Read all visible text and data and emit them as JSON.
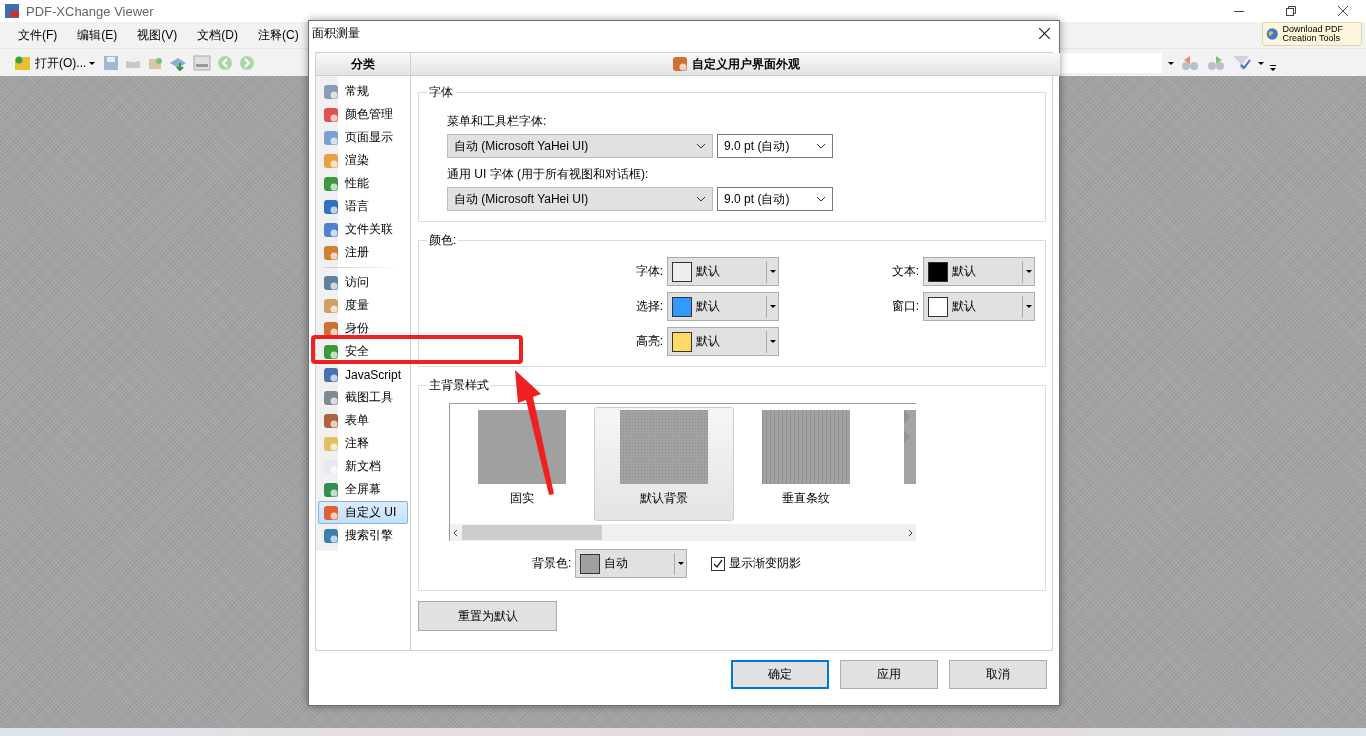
{
  "window": {
    "title": "PDF-XChange Viewer",
    "download_button": "Download PDF Creation Tools"
  },
  "menus": [
    {
      "label": "文件(F)"
    },
    {
      "label": "编辑(E)"
    },
    {
      "label": "视图(V)"
    },
    {
      "label": "文档(D)"
    },
    {
      "label": "注释(C)"
    }
  ],
  "toolbar": {
    "open_button": "打开(O)..."
  },
  "dialog": {
    "title": "面积测量",
    "category_header": "分类",
    "category_groups": [
      [
        {
          "label": "常规",
          "selected": false
        },
        {
          "label": "颜色管理",
          "selected": false
        },
        {
          "label": "页面显示",
          "selected": false
        },
        {
          "label": "渲染",
          "selected": false
        },
        {
          "label": "性能",
          "selected": false
        },
        {
          "label": "语言",
          "selected": false
        },
        {
          "label": "文件关联",
          "selected": false
        },
        {
          "label": "注册",
          "selected": false
        }
      ],
      [
        {
          "label": "访问",
          "selected": false
        },
        {
          "label": "度量",
          "selected": false
        },
        {
          "label": "身份",
          "selected": false
        },
        {
          "label": "安全",
          "selected": false
        },
        {
          "label": "JavaScript",
          "selected": false
        },
        {
          "label": "截图工具",
          "selected": false
        },
        {
          "label": "表单",
          "selected": false
        },
        {
          "label": "注释",
          "selected": false
        },
        {
          "label": "新文档",
          "selected": false
        },
        {
          "label": "全屏幕",
          "selected": false
        },
        {
          "label": "自定义 UI",
          "selected": true
        },
        {
          "label": "搜索引擎",
          "selected": false
        }
      ]
    ],
    "panel_header": "自定义用户界面外观",
    "font_group": {
      "title": "字体",
      "fields": [
        {
          "label": "菜单和工具栏字体:",
          "font": "自动 (Microsoft YaHei UI)",
          "size": "9.0 pt (自动)"
        },
        {
          "label": "通用 UI 字体 (用于所有视图和对话框):",
          "font": "自动 (Microsoft YaHei UI)",
          "size": "9.0 pt (自动)"
        }
      ]
    },
    "color_group": {
      "title": "颜色:",
      "items": [
        {
          "label": "字体:",
          "value": "默认",
          "color": "#efefef"
        },
        {
          "label": "文本:",
          "value": "默认",
          "color": "#000000"
        },
        {
          "label": "选择:",
          "value": "默认",
          "color": "#3399ff"
        },
        {
          "label": "窗口:",
          "value": "默认",
          "color": "#ffffff"
        },
        {
          "label": "高亮:",
          "value": "默认",
          "color": "#ffd966"
        }
      ]
    },
    "background_group": {
      "title": "主背景样式",
      "styles": [
        {
          "label": "固实",
          "kind": "solid",
          "selected": false
        },
        {
          "label": "默认背景",
          "kind": "dots",
          "selected": true
        },
        {
          "label": "垂直条纹",
          "kind": "stripes",
          "selected": false
        },
        {
          "kind": "diamonds",
          "selected": false
        }
      ],
      "bg_color": {
        "label": "背景色:",
        "value": "自动",
        "color": "#a0a0a0"
      },
      "gradient": {
        "label": "显示渐变阴影",
        "checked": true
      }
    },
    "reset_button": "重置为默认",
    "buttons": [
      {
        "label": "确定",
        "default": true
      },
      {
        "label": "应用",
        "default": false
      },
      {
        "label": "取消",
        "default": false
      }
    ]
  }
}
